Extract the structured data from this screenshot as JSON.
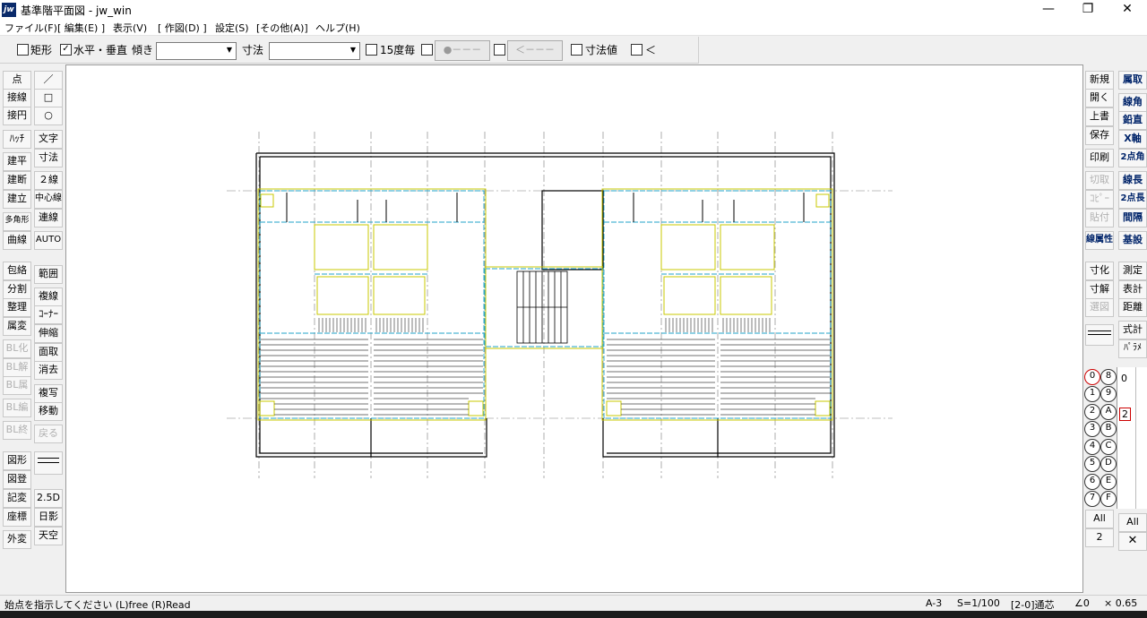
{
  "window": {
    "title": "基準階平面図 - jw_win",
    "icon": "jw",
    "controls": {
      "minimize": "—",
      "maximize": "❐",
      "close": "✕"
    }
  },
  "menu": [
    "ファイル(F)",
    "[ 編集(E) ]",
    "表示(V)",
    "[ 作図(D) ]",
    "設定(S)",
    "[その他(A)]",
    "ヘルプ(H)"
  ],
  "controlbar": {
    "rect_label": "矩形",
    "hv_label": "水平・垂直",
    "angle_label": "傾き",
    "dim_label": "寸法",
    "deg15_label": "15度毎",
    "circle_btn": "●－－－",
    "arrow_btn": "＜－－－",
    "dimvalue_label": "寸法値",
    "lt_label": "＜"
  },
  "left_tools": {
    "col1_a": [
      "点",
      "接線",
      "接円",
      "ﾊｯﾁ",
      "建平",
      "建断",
      "建立",
      "多角形",
      "曲線"
    ],
    "col1_b": [
      "包絡",
      "分割",
      "整理",
      "属変",
      "BL化",
      "BL解",
      "BL属",
      "BL編",
      "BL終"
    ],
    "col1_c": [
      "図形",
      "図登",
      "記変",
      "座標",
      "外変"
    ],
    "col2_a": [
      "／",
      "□",
      "○",
      "文字",
      "寸法",
      "２線",
      "中心線",
      "連線",
      "AUTO"
    ],
    "col2_b": [
      "範囲",
      "複線",
      "ｺｰﾅｰ",
      "伸縮",
      "面取",
      "消去",
      "複写",
      "移動",
      "戻る"
    ],
    "col2_c": [
      "2.5D",
      "日影",
      "天空"
    ]
  },
  "right_tools": {
    "col1_a": [
      "新規",
      "開く",
      "上書",
      "保存",
      "印刷",
      "切取",
      "ｺﾋﾟｰ",
      "貼付",
      "線属性"
    ],
    "col1_b": [
      "寸化",
      "寸解",
      "選図"
    ],
    "col2_a": [
      "属取",
      "線角",
      "鉛直",
      "X軸",
      "2点角",
      "線長",
      "2点長",
      "間隔",
      "基設"
    ],
    "col2_b": [
      "測定",
      "表計",
      "距離",
      "式計",
      "ﾊﾟﾗﾒ"
    ]
  },
  "layers": {
    "groups": [
      "0",
      "1",
      "2",
      "3",
      "4",
      "5",
      "6",
      "7"
    ],
    "layers": [
      "8",
      "9",
      "A",
      "B",
      "C",
      "D",
      "E",
      "F"
    ],
    "all_label": "All",
    "group_value": "2",
    "col3_values": [
      "0",
      "2"
    ]
  },
  "status": {
    "message": "始点を指示してください (L)free (R)Read",
    "paper": "A-3",
    "scale": "S=1/100",
    "layer": "[2-0]通芯",
    "angle": "∠0",
    "zoom": "× 0.65"
  }
}
